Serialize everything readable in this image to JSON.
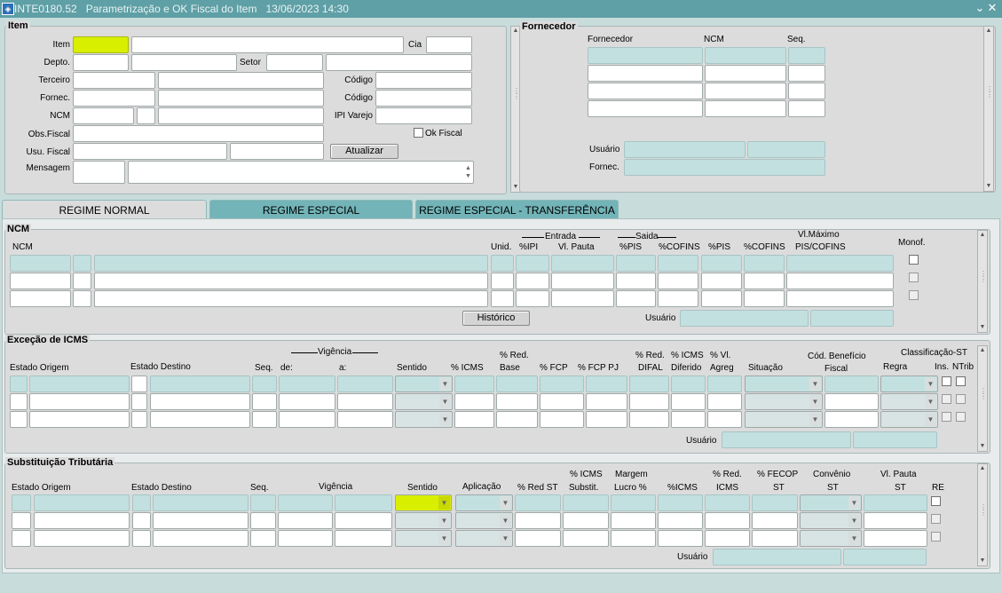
{
  "window": {
    "title": "INTE0180.52   Parametrização e OK Fiscal do Item   13/06/2023 14:30",
    "min_icon": "minimize-icon",
    "close_icon": "close-icon"
  },
  "item": {
    "title": "Item",
    "item_label": "Item",
    "cia_label": "Cia",
    "depto_label": "Depto.",
    "setor_label": "Setor",
    "terceiro_label": "Terceiro",
    "codigo_label": "Código",
    "fornec_label": "Fornec.",
    "codigo2_label": "Código",
    "ncm_label": "NCM",
    "ipi_varejo_label": "IPI Varejo",
    "obs_fiscal_label": "Obs.Fiscal",
    "ok_fiscal_label": "Ok Fiscal",
    "usu_fiscal_label": "Usu. Fiscal",
    "atualizar_label": "Atualizar",
    "mensagem_label": "Mensagem"
  },
  "fornecedor": {
    "title": "Fornecedor",
    "col_fornecedor": "Fornecedor",
    "col_ncm": "NCM",
    "col_seq": "Seq.",
    "usuario_label": "Usuário",
    "fornec_label": "Fornec."
  },
  "tabs": [
    {
      "label": "REGIME NORMAL",
      "active": true
    },
    {
      "label": "REGIME ESPECIAL",
      "active": false
    },
    {
      "label": "REGIME ESPECIAL - TRANSFERÊNCIA",
      "active": false
    }
  ],
  "ncm": {
    "title": "NCM",
    "col_ncm": "NCM",
    "col_unid": "Unid.",
    "entrada": "Entrada",
    "col_pipi": "%IPI",
    "col_vlpauta": "Vl. Pauta",
    "saida": "Saida",
    "col_ppis": "%PIS",
    "col_pcofins": "%COFINS",
    "col_ppis2": "%PIS",
    "col_pcofins2": "%COFINS",
    "col_vlmax1": "Vl.Máximo",
    "col_vlmax2": "PIS/COFINS",
    "col_monof": "Monof.",
    "historico_label": "Histórico",
    "usuario_label": "Usuário"
  },
  "icms": {
    "title": "Exceção de ICMS",
    "col_estado_origem": "Estado Origem",
    "col_estado_destino": "Estado Destino",
    "col_seq": "Seq.",
    "vigencia": "Vigência",
    "col_de": "de:",
    "col_a": "a:",
    "col_sentido": "Sentido",
    "col_picms": "% ICMS",
    "col_predbase1": "% Red.",
    "col_predbase2": "Base",
    "col_pfcp": "% FCP",
    "col_pfcppj": "% FCP PJ",
    "col_preddifal1": "% Red.",
    "col_preddifal2": "DIFAL",
    "col_picmsdif1": "% ICMS",
    "col_picmsdif2": "Diferido",
    "col_pvlagreg1": "% Vl.",
    "col_pvlagreg2": "Agreg",
    "col_situacao": "Situação",
    "col_codbenef1": "Cód. Benefício",
    "col_codbenef2": "Fiscal",
    "col_classif": "Classificação-ST",
    "col_regra": "Regra",
    "col_ins": "Ins.",
    "col_ntrib": "NTrib",
    "usuario_label": "Usuário"
  },
  "st": {
    "title": "Substituição Tributária",
    "col_estado_origem": "Estado Origem",
    "col_estado_destino": "Estado Destino",
    "col_seq": "Seq.",
    "col_vigencia": "Vigência",
    "col_sentido": "Sentido",
    "col_aplicacao": "Aplicação",
    "col_predst": "% Red ST",
    "col_picmssubst1": "% ICMS",
    "col_picmssubst2": "Substit.",
    "col_margem1": "Margem",
    "col_margem2": "Lucro %",
    "col_picms": "%ICMS",
    "col_predicms1": "% Red.",
    "col_predicms2": "ICMS",
    "col_pfecop1": "% FECOP",
    "col_pfecop2": "ST",
    "col_convenio1": "Convênio",
    "col_convenio2": "ST",
    "col_vlpauta1": "Vl. Pauta",
    "col_vlpauta2": "ST",
    "col_re": "RE",
    "usuario_label": "Usuário"
  },
  "colors": {
    "titlebar": "#5f9fa6",
    "panel": "#dcdcdc",
    "readonly_field": "#c3e0e0",
    "highlight_field": "#d8ef00",
    "tab_inactive": "#72b4b8"
  }
}
